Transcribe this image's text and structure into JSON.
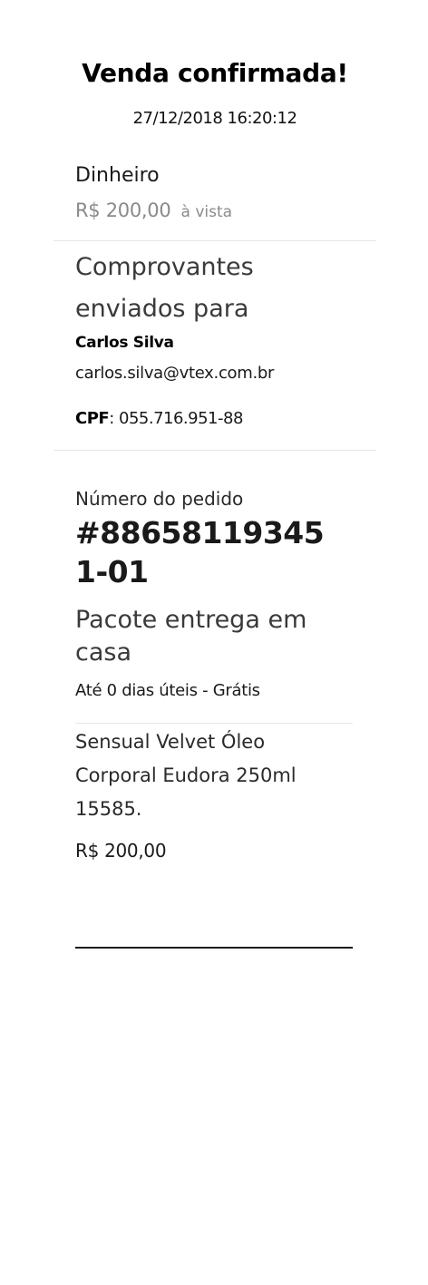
{
  "header": {
    "title": "Venda confirmada!",
    "datetime": "27/12/2018 16:20:12"
  },
  "payment": {
    "method": "Dinheiro",
    "amount": "R$ 200,00",
    "term": "à vista"
  },
  "recipient": {
    "heading": "Comprovantes enviados para",
    "name": "Carlos Silva",
    "email": "carlos.silva@vtex.com.br",
    "cpf_label": "CPF",
    "cpf_value": ": 055.716.951-88"
  },
  "order": {
    "label": "Número do pedido",
    "number": "#886581193451-01"
  },
  "shipping": {
    "name": "Pacote entrega em casa",
    "eta": "Até 0 dias úteis - Grátis"
  },
  "product": {
    "name": "Sensual Velvet Óleo Corporal Eudora 250ml 15585.",
    "price": "R$ 200,00"
  }
}
